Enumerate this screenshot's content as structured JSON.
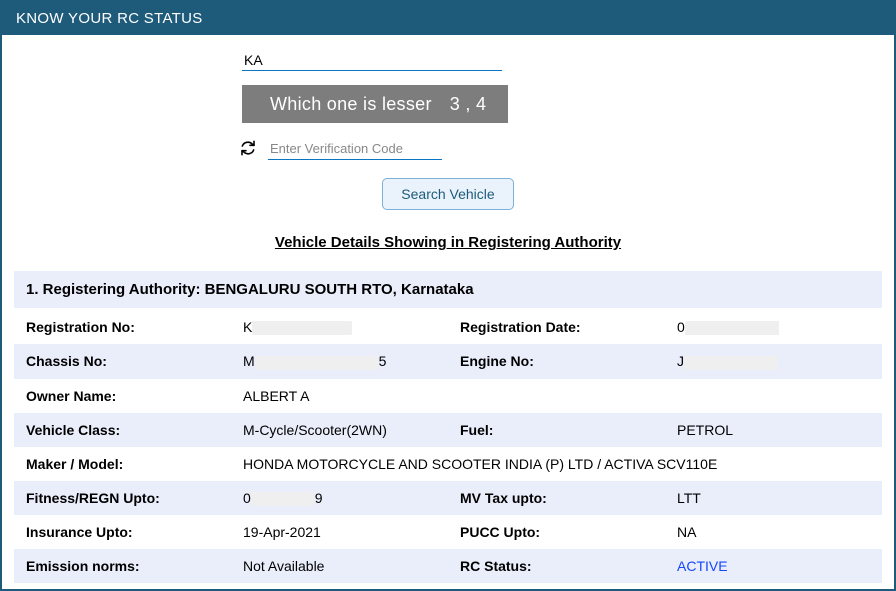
{
  "panel": {
    "title": "KNOW YOUR RC STATUS"
  },
  "search": {
    "reg_prefix": "KA",
    "captcha_question": "Which one is lesser",
    "captcha_numbers": "3  ,  4",
    "ver_placeholder": "Enter Verification Code",
    "btn": "Search Vehicle"
  },
  "section_title": "Vehicle Details Showing in Registering Authority",
  "authority_line": "1. Registering Authority: BENGALURU SOUTH RTO, Karnataka",
  "rows": [
    {
      "l1": "Registration No:",
      "v1_pre": "K",
      "v1_mask_w": 100,
      "l2": "Registration Date:",
      "v2_pre": "0",
      "v2_mask_w": 94
    },
    {
      "l1": "Chassis No:",
      "v1_pre": "M",
      "v1_mid_mask_w": 124,
      "v1_post": "5",
      "l2": "Engine No:",
      "v2_pre": "J",
      "v2_mask_w": 94
    },
    {
      "l1": "Owner Name:",
      "v1": "ALBERT A",
      "l2": "",
      "v2": ""
    },
    {
      "l1": "Vehicle Class:",
      "v1": "M-Cycle/Scooter(2WN)",
      "l2": "Fuel:",
      "v2": "PETROL"
    },
    {
      "l1": "Maker / Model:",
      "v1": "HONDA MOTORCYCLE AND SCOOTER INDIA (P) LTD / ACTIVA SCV110E",
      "wide": true
    },
    {
      "l1": "Fitness/REGN Upto:",
      "v1_pre": "0",
      "v1_mid_mask_w": 64,
      "v1_post": "9",
      "l2": "MV Tax upto:",
      "v2": "LTT"
    },
    {
      "l1": "Insurance Upto:",
      "v1": "19-Apr-2021",
      "l2": "PUCC Upto:",
      "v2": "NA"
    },
    {
      "l1": "Emission norms:",
      "v1": "Not Available",
      "l2": "RC Status:",
      "v2": "ACTIVE",
      "v2_class": "active"
    }
  ]
}
